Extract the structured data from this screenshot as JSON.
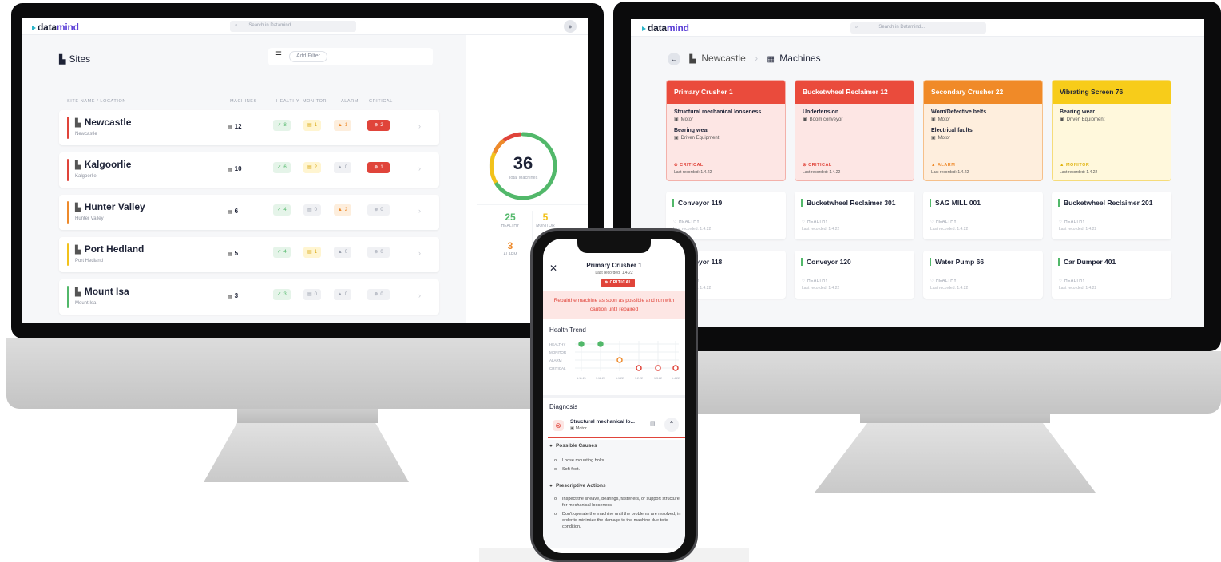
{
  "app": {
    "logo": "datamind",
    "logo_accent": "mind",
    "logo_main": "data",
    "search_placeholder": "Search in Datamind..."
  },
  "sites": {
    "title": "Sites",
    "add_filter": "Add Filter",
    "columns": [
      "SITE NAME / LOCATION",
      "MACHINES",
      "HEALTHY",
      "MONITOR",
      "ALARM",
      "CRITICAL"
    ],
    "rows": [
      {
        "name": "Newcastle",
        "location": "Newcastle",
        "machines": "12",
        "healthy": "8",
        "monitor": "1",
        "alarm": "1",
        "critical": "2",
        "color": "#e0443a"
      },
      {
        "name": "Kalgoorlie",
        "location": "Kalgoorlie",
        "machines": "10",
        "healthy": "6",
        "monitor": "2",
        "alarm": "0",
        "critical": "1",
        "color": "#e0443a"
      },
      {
        "name": "Hunter Valley",
        "location": "Hunter Valley",
        "machines": "6",
        "healthy": "4",
        "monitor": "0",
        "alarm": "2",
        "critical": "0",
        "color": "#ee8a2b"
      },
      {
        "name": "Port Hedland",
        "location": "Port Hedland",
        "machines": "5",
        "healthy": "4",
        "monitor": "1",
        "alarm": "0",
        "critical": "0",
        "color": "#f2c21b"
      },
      {
        "name": "Mount Isa",
        "location": "Mount Isa",
        "machines": "3",
        "healthy": "3",
        "monitor": "0",
        "alarm": "0",
        "critical": "0",
        "color": "#52b86a"
      }
    ]
  },
  "summary": {
    "total": "36",
    "total_label": "Total Machines",
    "healthy": "25",
    "healthy_label": "HEALTHY",
    "monitor": "5",
    "monitor_label": "MONITOR",
    "alarm": "3",
    "alarm_label": "ALARM"
  },
  "machines": {
    "breadcrumb_site": "Newcastle",
    "breadcrumb_page": "Machines",
    "status_cards": [
      {
        "title": "Primary Crusher 1",
        "color": "#ea4b3c",
        "bg": "#fde6e4",
        "border": "#f3b1aa",
        "faults": [
          {
            "f": "Structural mechanical looseness",
            "c": "Motor"
          },
          {
            "f": "Bearing wear",
            "c": "Driven Equipment"
          }
        ],
        "status": "CRITICAL",
        "recorded": "Last recorded: 1.4.22",
        "scolor": "#e0443a"
      },
      {
        "title": "Bucketwheel Reclaimer 12",
        "color": "#ea4b3c",
        "bg": "#fde6e4",
        "border": "#f3b1aa",
        "faults": [
          {
            "f": "Undertension",
            "c": "Boom conveyor"
          }
        ],
        "status": "CRITICAL",
        "recorded": "Last recorded: 1.4.22",
        "scolor": "#e0443a"
      },
      {
        "title": "Secondary Crusher 22",
        "color": "#f08a28",
        "bg": "#feeedd",
        "border": "#f6c08a",
        "faults": [
          {
            "f": "Worn/Defective belts",
            "c": "Motor"
          },
          {
            "f": "Electrical faults",
            "c": "Motor"
          }
        ],
        "status": "ALARM",
        "recorded": "Last recorded: 1.4.22",
        "scolor": "#ee8a2b"
      },
      {
        "title": "Vibrating Screen 76",
        "color": "#f7cc1a",
        "bg": "#fff8dc",
        "border": "#f6dc7a",
        "faults": [
          {
            "f": "Bearing wear",
            "c": "Driven Equipment"
          }
        ],
        "status": "MONITOR",
        "recorded": "Last recorded: 1.4.22",
        "scolor": "#e0b30f",
        "dark_title": true
      }
    ],
    "healthy_cards": [
      {
        "name": "Conveyor 119"
      },
      {
        "name": "Bucketwheel Reclaimer 301"
      },
      {
        "name": "SAG MILL 001"
      },
      {
        "name": "Bucketwheel Reclaimer 201"
      },
      {
        "name": "Conveyor 118"
      },
      {
        "name": "Conveyor 120"
      },
      {
        "name": "Water Pump 66"
      },
      {
        "name": "Car Dumper 401"
      }
    ],
    "healthy_label": "HEALTHY",
    "recorded": "Last recorded: 1.4.22"
  },
  "phone": {
    "title": "Primary Crusher 1",
    "recorded": "Last recorded: 1.4.22",
    "badge": "CRITICAL",
    "alert": "Repairthe machine as soon as possible and run with caution until repaired",
    "trend_title": "Health Trend",
    "trend_labels": [
      "HEALTHY",
      "MONITOR",
      "ALARM",
      "CRITICAL"
    ],
    "trend_dates": [
      "1.11.21",
      "1.12.21",
      "1.1.22",
      "1.2.22",
      "1.3.22",
      "1.4.22"
    ],
    "diagnosis_title": "Diagnosis",
    "diag_fault": "Structural mechanical lo...",
    "diag_component": "Motor",
    "causes_title": "Possible Causes",
    "causes": [
      "Loose mounting bolts.",
      "Soft foot."
    ],
    "actions_title": "Prescriptive Actions",
    "actions": [
      "Inspect the sheave, bearings, fasteners, or support structure for mechanical looseness",
      "Don't operate the machine until the problems are resolved, in order to minimize the damage to the machine due toits condition."
    ]
  }
}
